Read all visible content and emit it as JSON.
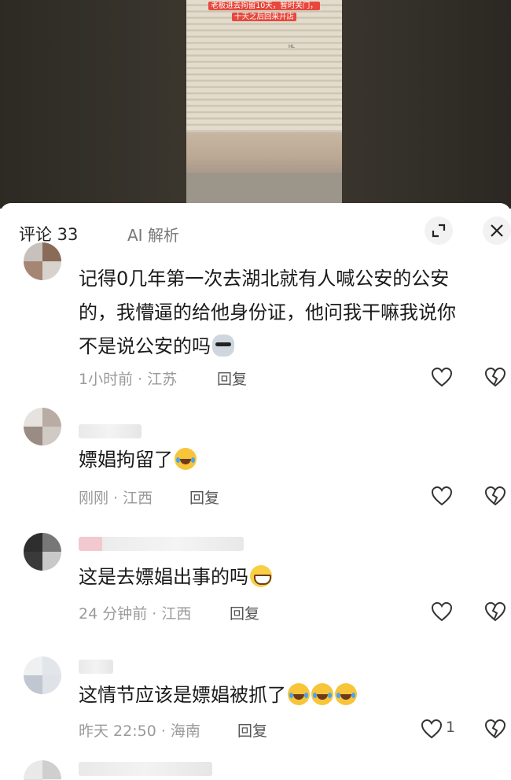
{
  "video": {
    "caption_lines": [
      "老板进去拘留10天，暂时关门，",
      "十天之后回来开店"
    ],
    "shutter_mark": "HL"
  },
  "header": {
    "comments_label": "评论 33",
    "ai_label": "AI 解析"
  },
  "comments": [
    {
      "lines": [
        "记得0几年第一次去湖北就有人喊公安的公安",
        "的，我懵逼的给他身份证，他问我干嘛我说你",
        "不是说公安的吗"
      ],
      "emoji": [
        "dog"
      ],
      "time": "1小时前 · 江苏",
      "reply": "回复",
      "likes": ""
    },
    {
      "lines": [
        "嫖娼拘留了"
      ],
      "emoji": [
        "laugh"
      ],
      "time": "刚刚 · 江西",
      "reply": "回复",
      "likes": ""
    },
    {
      "lines": [
        "这是去嫖娼出事的吗"
      ],
      "emoji": [
        "grin"
      ],
      "time": "24 分钟前 · 江西",
      "reply": "回复",
      "likes": ""
    },
    {
      "lines": [
        "这情节应该是嫖娼被抓了"
      ],
      "emoji": [
        "laugh",
        "laugh",
        "laugh"
      ],
      "time": "昨天 22:50 · 海南",
      "reply": "回复",
      "likes": "1"
    }
  ],
  "colors": {
    "accent_caption": "#e7473c",
    "meta_text": "#9a9a9a"
  },
  "icons": [
    "expand-icon",
    "close-icon",
    "heart-icon",
    "broken-heart-icon"
  ]
}
